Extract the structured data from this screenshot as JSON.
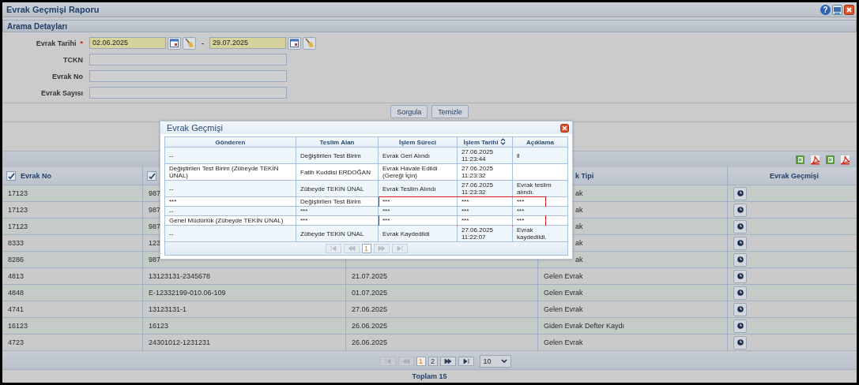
{
  "window": {
    "title": "Evrak Geçmişi Raporu",
    "help": "?"
  },
  "search": {
    "title": "Arama Detayları",
    "fields": [
      {
        "kind": "date_range",
        "label": "Evrak Tarihi",
        "required_mark": "*",
        "from": "02.06.2025",
        "separator": "-",
        "to": "29.07.2025"
      },
      {
        "kind": "text",
        "label": "TCKN"
      },
      {
        "kind": "text",
        "label": "Evrak No"
      },
      {
        "kind": "text",
        "label": "Evrak Sayısı"
      }
    ],
    "buttons": [
      "Sorgula",
      "Temizle"
    ]
  },
  "table": {
    "columns": [
      {
        "label": "Evrak No",
        "checked": true
      },
      {
        "checked": true
      },
      {},
      {
        "label": "k Tipi"
      },
      {
        "label": "Evrak Geçmişi"
      }
    ],
    "rows": [
      {
        "evrak_no": "17123",
        "column_2": "987",
        "evrak_tipi": "ak"
      },
      {
        "evrak_no": "17123",
        "column_2": "987",
        "evrak_tipi": "ak"
      },
      {
        "evrak_no": "17123",
        "column_2": "987",
        "evrak_tipi": "ak"
      },
      {
        "evrak_no": "8333",
        "column_2": "123",
        "evrak_tipi": "ak"
      },
      {
        "evrak_no": "8286",
        "column_2": "987",
        "evrak_tipi": "ak"
      },
      {
        "evrak_no": "4813",
        "column_2": "13123131-2345678",
        "column_3": "21.07.2025",
        "evrak_tipi": "Gelen Evrak"
      },
      {
        "evrak_no": "4848",
        "column_2": "E-12332199-010.06-109",
        "column_3": "01.07.2025",
        "evrak_tipi": "Gelen Evrak"
      },
      {
        "evrak_no": "4741",
        "column_2": "13123131-1",
        "column_3": "27.06.2025",
        "evrak_tipi": "Gelen Evrak"
      },
      {
        "evrak_no": "16123",
        "column_2": "16123",
        "column_3": "26.06.2025",
        "evrak_tipi": "Giden Evrak Defter Kaydı"
      },
      {
        "evrak_no": "4723",
        "column_2": "24301012-1231231",
        "column_3": "26.06.2025",
        "evrak_tipi": "Gelen Evrak"
      }
    ],
    "pagination": {
      "nav": [
        {
          "kind": "first",
          "disabled": true
        },
        {
          "kind": "prev",
          "disabled": true
        },
        {
          "kind": "next",
          "disabled": false
        },
        {
          "kind": "last",
          "disabled": false
        }
      ],
      "pages": [
        {
          "label": "1",
          "selected": true
        },
        {
          "label": "2",
          "selected": false
        }
      ],
      "page_size": "10"
    },
    "total": "Toplam 15"
  },
  "dialog": {
    "title": "Evrak Geçmişi",
    "columns": [
      {
        "label": "Gönderen"
      },
      {
        "label": "Teslim Alan"
      },
      {
        "label": "İşlem Süreci"
      },
      {
        "label": "İşlem Tarihi",
        "sortable": true
      },
      {
        "label": "Açıklama"
      }
    ],
    "rows": [
      {
        "gonderen": "--",
        "teslim_alan": "Değiştirilen Test Birim",
        "islem_sureci": "Evrak Geri Alındı",
        "islem_tarihi": "27.06.2025 11:23:44",
        "aciklama": "ll"
      },
      {
        "gonderen": "Değiştirilen Test Birim (Zübeyde TEKİN ÜNAL)",
        "teslim_alan": "Fatih Kuddisi ERDOĞAN",
        "islem_sureci": "Evrak Havale Edildi (Gereği İçin)",
        "islem_tarihi": "27.06.2025 11:23:32"
      },
      {
        "gonderen": "--",
        "teslim_alan": "Zübeyde TEKİN ÜNAL",
        "islem_sureci": "Evrak Teslim Alındı",
        "islem_tarihi": "27.06.2025 11:23:32",
        "aciklama": "Evrak teslim alındı."
      },
      {
        "gonderen": "***",
        "teslim_alan": "Değiştirilen Test Birim",
        "islem_sureci": "***",
        "islem_tarihi": "***",
        "aciklama": "***"
      },
      {
        "gonderen": "--",
        "teslim_alan": "***",
        "islem_sureci": "***",
        "islem_tarihi": "***",
        "aciklama": "***"
      },
      {
        "gonderen": "Genel Müdürlük (Zübeyde TEKİN ÜNAL)",
        "teslim_alan": "***",
        "islem_sureci": "***",
        "islem_tarihi": "***",
        "aciklama": "***"
      },
      {
        "gonderen": "--",
        "teslim_alan": "Zübeyde TEKİN ÜNAL",
        "islem_sureci": "Evrak Kaydedildi",
        "islem_tarihi": "27.06.2025 11:22:07",
        "aciklama": "Evrak kaydedildi."
      }
    ],
    "pagination": {
      "nav": [
        {
          "kind": "first",
          "disabled": true
        },
        {
          "kind": "prev",
          "disabled": true
        },
        {
          "kind": "next",
          "disabled": true
        },
        {
          "kind": "last",
          "disabled": true
        }
      ],
      "pages": [
        {
          "label": "1",
          "selected": true
        }
      ]
    }
  }
}
